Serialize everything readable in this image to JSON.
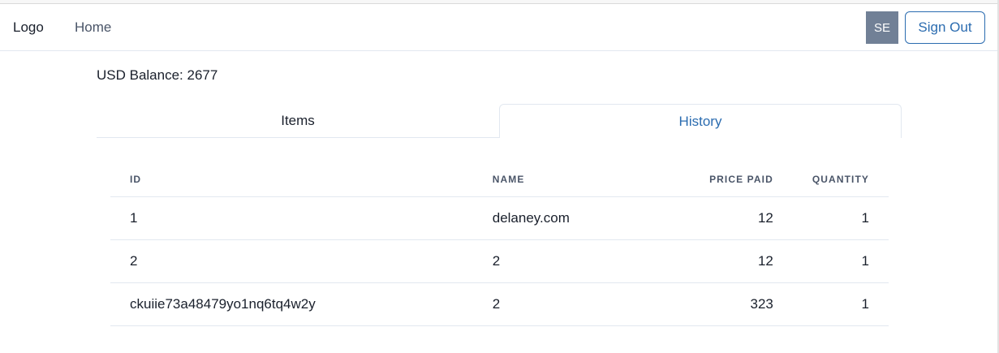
{
  "navbar": {
    "logo": "Logo",
    "home_link": "Home",
    "avatar_initials": "SE",
    "sign_out_label": "Sign Out"
  },
  "balance": {
    "label": "USD Balance: ",
    "value": "2677"
  },
  "tabs": [
    {
      "label": "Items",
      "selected": false
    },
    {
      "label": "History",
      "selected": true
    }
  ],
  "history_table": {
    "headers": [
      "ID",
      "NAME",
      "PRICE PAID",
      "QUANTITY"
    ],
    "rows": [
      {
        "id": "1",
        "name": "delaney.com",
        "price_paid": "12",
        "quantity": "1"
      },
      {
        "id": "2",
        "name": "2",
        "price_paid": "12",
        "quantity": "1"
      },
      {
        "id": "ckuiie73a48479yo1nq6tq4w2y",
        "name": "2",
        "price_paid": "323",
        "quantity": "1"
      }
    ]
  },
  "colors": {
    "accent": "#2b6cb0",
    "avatar_bg": "#718096",
    "border": "#e2e8f0"
  }
}
